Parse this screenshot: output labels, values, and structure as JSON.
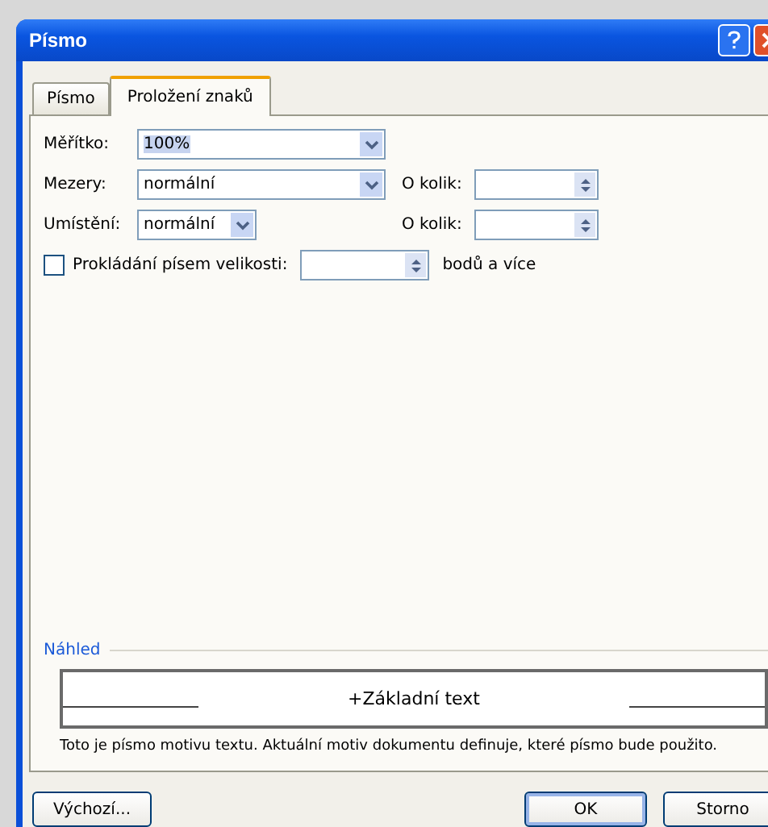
{
  "window": {
    "title": "Písmo"
  },
  "tabs": [
    {
      "label": "Písmo",
      "selected": false
    },
    {
      "label": "Proložení znaků",
      "selected": true
    }
  ],
  "fields": [
    {
      "label": "Měřítko:",
      "value": "100%",
      "kind": "dropdown",
      "highlighted": true
    },
    {
      "label": "Mezery:",
      "value": "normální",
      "kind": "dropdown",
      "highlighted": false,
      "extra": {
        "label": "O kolik:"
      }
    },
    {
      "label": "Umístění:",
      "value": "normální",
      "kind": "short-dropdown",
      "highlighted": false,
      "extra": {
        "label": "O kolik:"
      }
    }
  ],
  "kerning": {
    "label": "Prokládání písem velikosti:",
    "checked": false,
    "suffix": "bodů a více"
  },
  "preview": {
    "heading": "Náhled",
    "sample": "+Základní text",
    "note": "Toto je písmo motivu textu. Aktuální motiv dokumentu definuje, které písmo bude použito."
  },
  "buttons": [
    {
      "label": "Výchozí...",
      "kind": "left"
    },
    {
      "label": "OK",
      "kind": "default"
    },
    {
      "label": "Storno",
      "kind": "normal"
    }
  ]
}
